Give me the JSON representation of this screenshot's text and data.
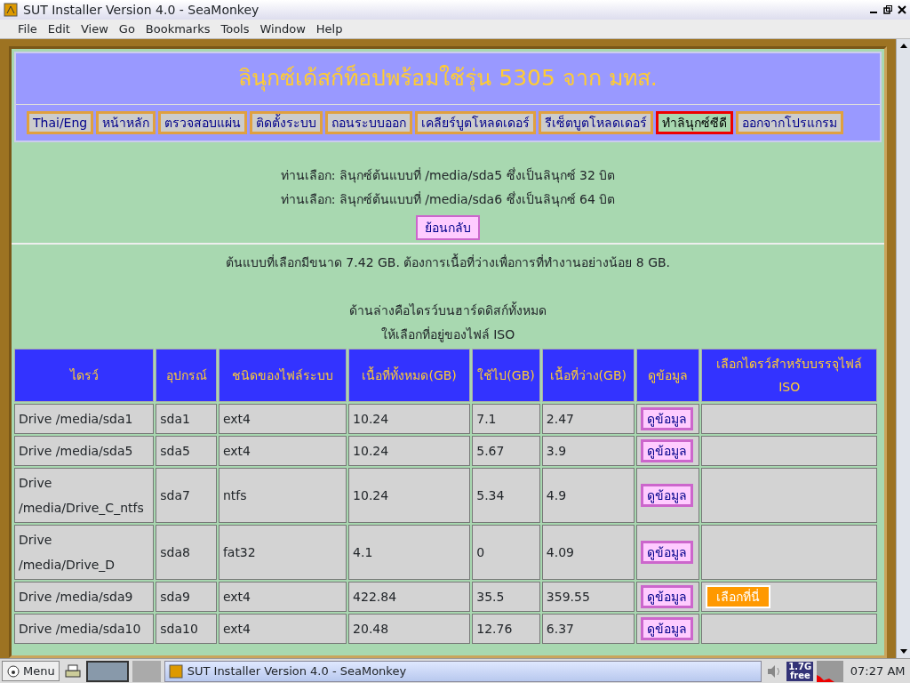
{
  "window": {
    "title": "SUT Installer Version 4.0 - SeaMonkey"
  },
  "menu": [
    "File",
    "Edit",
    "View",
    "Go",
    "Bookmarks",
    "Tools",
    "Window",
    "Help"
  ],
  "page": {
    "title": "ลินุกซ์เด้สก์ท็อปพร้อมใช้รุ่น  5305  จาก  มทส.",
    "nav": [
      {
        "label": "Thai/Eng",
        "selected": false
      },
      {
        "label": "หน้าหลัก",
        "selected": false
      },
      {
        "label": "ตรวจสอบแผ่น",
        "selected": false
      },
      {
        "label": "ติดตั้งระบบ",
        "selected": false
      },
      {
        "label": "ถอนระบบออก",
        "selected": false
      },
      {
        "label": "เคลียร์บูตโหลดเดอร์",
        "selected": false
      },
      {
        "label": "รีเซ็ตบูตโหลดเดอร์",
        "selected": false
      },
      {
        "label": "ทำลินุกซ์ซีดี",
        "selected": true
      },
      {
        "label": "ออกจากโปรแกรม",
        "selected": false
      }
    ],
    "choices": [
      "ท่านเลือก:  ลินุกซ์ต้นแบบที่  /media/sda5  ซึ่งเป็นลินุกซ์  32  บิต",
      "ท่านเลือก:  ลินุกซ์ต้นแบบที่  /media/sda6  ซึ่งเป็นลินุกซ์  64  บิต"
    ],
    "back_button": "ย้อนกลับ",
    "size_note": "ต้นแบบที่เลือกมีขนาด  7.42  GB.  ต้องการเนื้อที่ว่างเพื่อการที่ทำงานอย่างน้อย  8  GB.",
    "instructions": [
      "ด้านล่างคือไดรว์บนฮาร์ดดิสก์ทั้งหมด",
      "ให้เลือกที่อยู่ของไฟล์  ISO"
    ],
    "table": {
      "columns": [
        "ไดรว์",
        "อุปกรณ์",
        "ชนิดของไฟล์ระบบ",
        "เนื้อที่ทั้งหมด(GB)",
        "ใช้ไป(GB)",
        "เนื้อที่ว่าง(GB)",
        "ดูข้อมูล",
        "เลือกไดรว์สำหรับบรรจุไฟล์ ISO"
      ],
      "rows": [
        {
          "drive": "Drive  /media/sda1",
          "device": "sda1",
          "fs": "ext4",
          "total": "10.24",
          "used": "7.1",
          "free": "2.47",
          "info_button": "ดูข้อมูล"
        },
        {
          "drive": "Drive  /media/sda5",
          "device": "sda5",
          "fs": "ext4",
          "total": "10.24",
          "used": "5.67",
          "free": "3.9",
          "info_button": "ดูข้อมูล"
        },
        {
          "drive": "Drive  /media/Drive_C_ntfs",
          "device": "sda7",
          "fs": "ntfs",
          "total": "10.24",
          "used": "5.34",
          "free": "4.9",
          "info_button": "ดูข้อมูล"
        },
        {
          "drive": "Drive  /media/Drive_D",
          "device": "sda8",
          "fs": "fat32",
          "total": "4.1",
          "used": "0",
          "free": "4.09",
          "info_button": "ดูข้อมูล"
        },
        {
          "drive": "Drive  /media/sda9",
          "device": "sda9",
          "fs": "ext4",
          "total": "422.84",
          "used": "35.5",
          "free": "359.55",
          "info_button": "ดูข้อมูล",
          "select_button": "เลือกที่นี่"
        },
        {
          "drive": "Drive  /media/sda10",
          "device": "sda10",
          "fs": "ext4",
          "total": "20.48",
          "used": "12.76",
          "free": "6.37",
          "info_button": "ดูข้อมูล"
        }
      ]
    }
  },
  "taskbar": {
    "menu": "Menu",
    "task": "SUT Installer Version 4.0 - SeaMonkey",
    "memory": [
      "1.7G",
      "free"
    ],
    "clock": "07:27 AM"
  }
}
